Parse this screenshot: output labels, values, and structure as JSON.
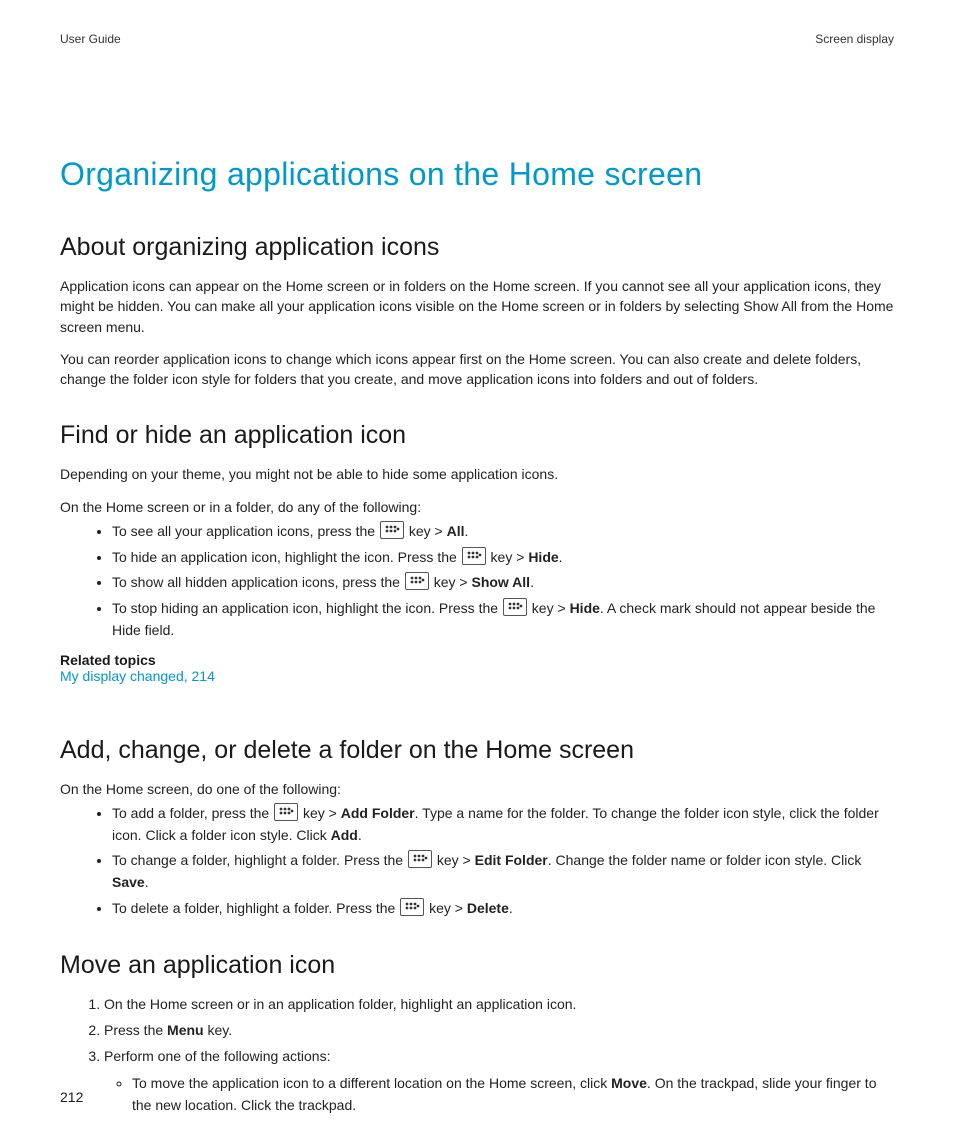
{
  "header": {
    "left": "User Guide",
    "right": "Screen display"
  },
  "title": "Organizing applications on the Home screen",
  "s1": {
    "heading": "About organizing application icons",
    "p1": "Application icons can appear on the Home screen or in folders on the Home screen. If you cannot see all your application icons, they might be hidden. You can make all your application icons visible on the Home screen or in folders by selecting Show All from the Home screen menu.",
    "p2": "You can reorder application icons to change which icons appear first on the Home screen. You can also create and delete folders, change the folder icon style for folders that you create, and move application icons into folders and out of folders."
  },
  "s2": {
    "heading": "Find or hide an application icon",
    "intro1": "Depending on your theme, you might not be able to hide some application icons.",
    "intro2": "On the Home screen or in a folder, do any of the following:",
    "b1a": "To see all your application icons, press the ",
    "b1b": " key > ",
    "b1c": "All",
    "b1d": ".",
    "b2a": "To hide an application icon, highlight the icon. Press the ",
    "b2b": " key > ",
    "b2c": "Hide",
    "b2d": ".",
    "b3a": "To show all hidden application icons, press the ",
    "b3b": " key > ",
    "b3c": "Show All",
    "b3d": ".",
    "b4a": "To stop hiding an application icon, highlight the icon. Press the ",
    "b4b": " key > ",
    "b4c": "Hide",
    "b4d": ". A check mark should not appear beside the Hide field.",
    "related_label": "Related topics",
    "related_link": "My display changed, 214"
  },
  "s3": {
    "heading": "Add, change, or delete a folder on the Home screen",
    "intro": "On the Home screen, do one of the following:",
    "b1a": "To add a folder, press the ",
    "b1b": " key > ",
    "b1c": "Add Folder",
    "b1d": ". Type a name for the folder. To change the folder icon style, click the folder icon. Click a folder icon style. Click ",
    "b1e": "Add",
    "b1f": ".",
    "b2a": "To change a folder, highlight a folder. Press the ",
    "b2b": " key > ",
    "b2c": "Edit Folder",
    "b2d": ". Change the folder name or folder icon style. Click ",
    "b2e": "Save",
    "b2f": ".",
    "b3a": "To delete a folder, highlight a folder. Press the ",
    "b3b": " key > ",
    "b3c": "Delete",
    "b3d": "."
  },
  "s4": {
    "heading": "Move an application icon",
    "step1": "On the Home screen or in an application folder, highlight an application icon.",
    "step2a": "Press the ",
    "step2b": "Menu",
    "step2c": " key.",
    "step3": "Perform one of the following actions:",
    "sub_a": "To move the application icon to a different location on the Home screen, click ",
    "sub_b": "Move",
    "sub_c": ". On the trackpad, slide your finger to the new location. Click the trackpad."
  },
  "page_number": "212"
}
